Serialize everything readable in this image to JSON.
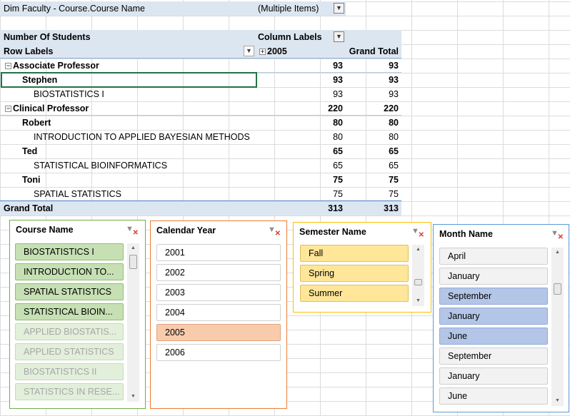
{
  "filter": {
    "label": "Dim Faculty - Course.Course Name",
    "value": "(Multiple Items)"
  },
  "pivot": {
    "measure_label": "Number Of Students",
    "column_labels": "Column Labels",
    "row_labels": "Row Labels",
    "col_year": "2005",
    "grand_total_header": "Grand Total",
    "rows": [
      {
        "label": "Associate Professor",
        "v2005": "93",
        "total": "93"
      },
      {
        "label": "Stephen",
        "v2005": "93",
        "total": "93"
      },
      {
        "label": "BIOSTATISTICS I",
        "v2005": "93",
        "total": "93"
      },
      {
        "label": "Clinical Professor",
        "v2005": "220",
        "total": "220"
      },
      {
        "label": "Robert",
        "v2005": "80",
        "total": "80"
      },
      {
        "label": "INTRODUCTION TO APPLIED BAYESIAN METHODS",
        "v2005": "80",
        "total": "80"
      },
      {
        "label": "Ted",
        "v2005": "65",
        "total": "65"
      },
      {
        "label": "STATISTICAL BIOINFORMATICS",
        "v2005": "65",
        "total": "65"
      },
      {
        "label": "Toni",
        "v2005": "75",
        "total": "75"
      },
      {
        "label": "SPATIAL STATISTICS",
        "v2005": "75",
        "total": "75"
      }
    ],
    "grand_total": {
      "label": "Grand Total",
      "v2005": "313",
      "total": "313"
    }
  },
  "slicers": {
    "course": {
      "title": "Course Name",
      "items": [
        "BIOSTATISTICS I",
        "INTRODUCTION TO...",
        "SPATIAL STATISTICS",
        "STATISTICAL BIOIN...",
        "APPLIED BIOSTATIS...",
        "APPLIED STATISTICS",
        "BIOSTATISTICS II",
        "STATISTICS IN RESE..."
      ]
    },
    "year": {
      "title": "Calendar Year",
      "items": [
        "2001",
        "2002",
        "2003",
        "2004",
        "2005",
        "2006"
      ]
    },
    "semester": {
      "title": "Semester Name",
      "items": [
        "Fall",
        "Spring",
        "Summer"
      ]
    },
    "month": {
      "title": "Month Name",
      "items": [
        "April",
        "January",
        "September",
        "January",
        "June",
        "September",
        "January",
        "June"
      ]
    }
  },
  "colors": {
    "pivot_header_bg": "#dce6f1",
    "course_selected": "#c6e0b4",
    "course_border": "#70ad47",
    "year_selected": "#f8cbad",
    "year_border": "#ed7d31",
    "semester_selected": "#ffe699",
    "semester_border": "#ffc000",
    "month_selected": "#b4c6e7",
    "month_border": "#5b9bd5"
  },
  "icons": {
    "filter": "filter-icon",
    "dropdown": "dropdown-arrow-icon",
    "clear_filter": "clear-filter-icon",
    "collapse": "collapse-minus-icon",
    "expand": "expand-plus-icon"
  }
}
